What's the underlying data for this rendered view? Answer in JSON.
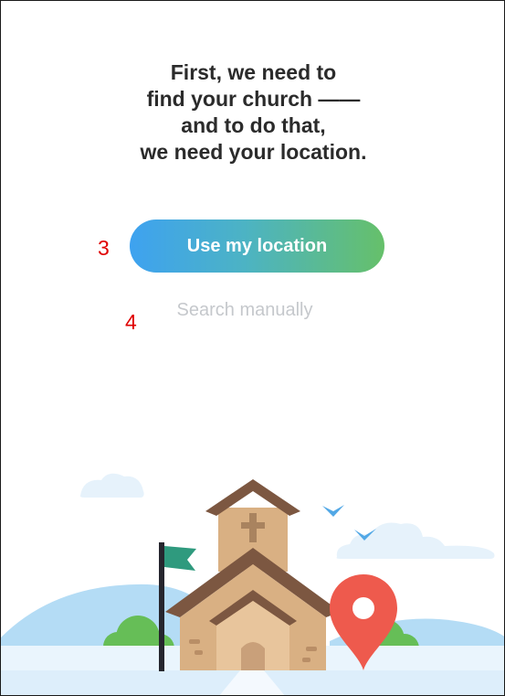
{
  "heading": {
    "lines": [
      "First, we need to",
      "find your church ——",
      "and to do that,",
      "we need your location."
    ]
  },
  "buttons": {
    "use_location": "Use my location",
    "search_manually": "Search manually"
  },
  "annotations": {
    "marker_3": "3",
    "marker_4": "4"
  },
  "colors": {
    "gradient_start": "#3ea2f0",
    "gradient_end": "#66c06a",
    "heading_text": "#2b2b2b",
    "link_text": "#c5c8cc",
    "annotation": "#e00000",
    "pin": "#ee5a4d"
  },
  "illustration": {
    "icons": [
      "church-icon",
      "flag-icon",
      "location-pin-icon",
      "bird-icon",
      "cloud-icon",
      "tree-icon",
      "hill-icon"
    ]
  }
}
